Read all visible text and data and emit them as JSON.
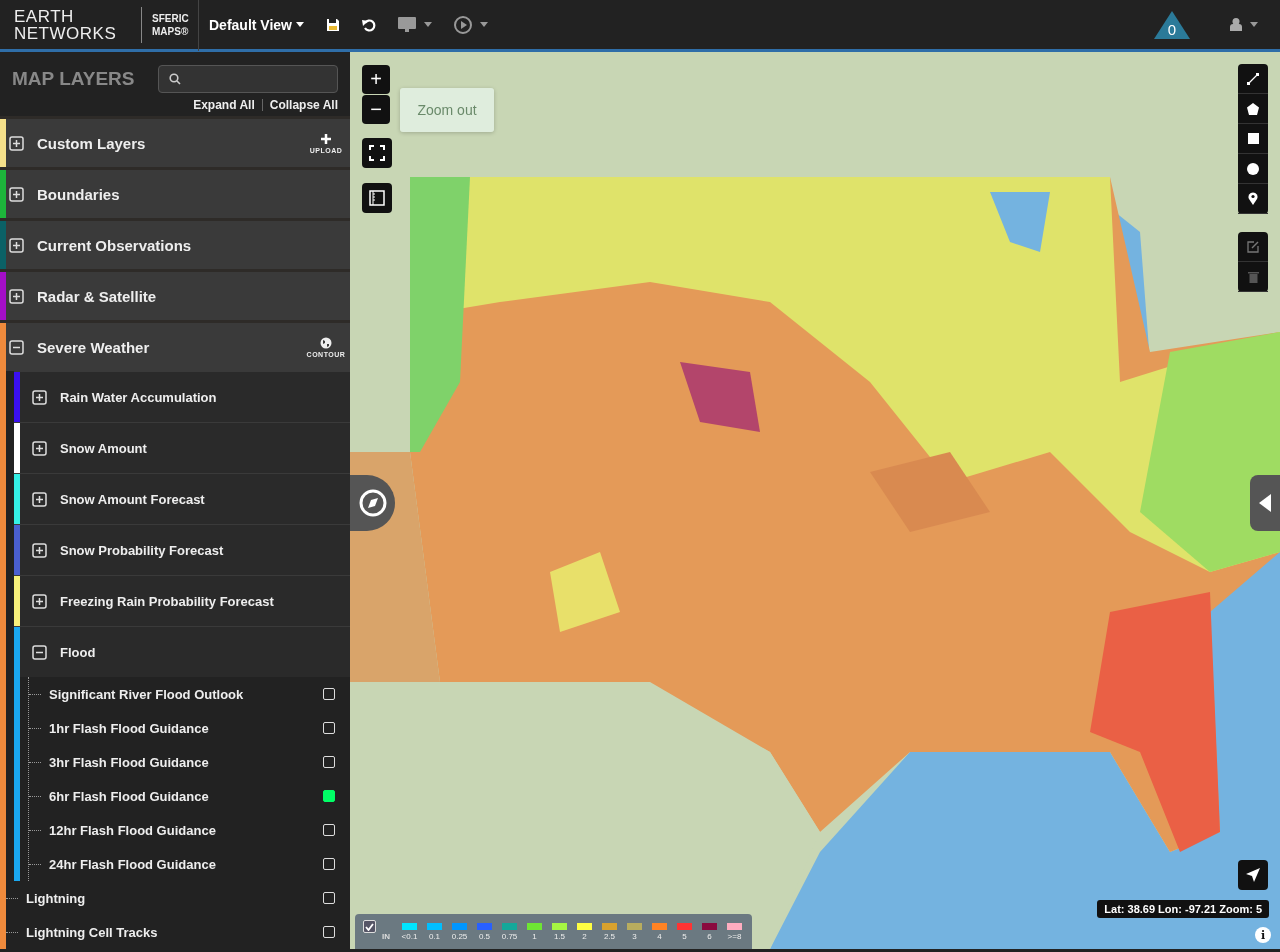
{
  "header": {
    "logo": {
      "line1": "EARTH",
      "line2": "NETWORKS"
    },
    "product": {
      "line1": "SFERIC",
      "line2": "MAPS®"
    },
    "view_menu": "Default View",
    "alert_count": "0"
  },
  "sidebar": {
    "title": "MAP LAYERS",
    "links": [
      "Expand All",
      "Collapse All"
    ],
    "groups": [
      {
        "label": "Custom Layers",
        "color": "#f5e08a",
        "expanded": false,
        "action": {
          "kind": "upload",
          "label": "UPLOAD"
        }
      },
      {
        "label": "Boundaries",
        "color": "#1db53b",
        "expanded": false
      },
      {
        "label": "Current Observations",
        "color": "#0b6166",
        "expanded": false
      },
      {
        "label": "Radar & Satellite",
        "color": "#a40ec7",
        "expanded": false
      },
      {
        "label": "Severe Weather",
        "color": "#ef8a3c",
        "expanded": true,
        "action": {
          "kind": "contour",
          "label": "CONTOUR"
        },
        "children": [
          {
            "kind": "group",
            "label": "Rain Water Accumulation",
            "color": "#3a10f0",
            "expanded": false
          },
          {
            "kind": "group",
            "label": "Snow Amount",
            "color": "#ffffff",
            "expanded": false
          },
          {
            "kind": "group",
            "label": "Snow Amount Forecast",
            "color": "#35f0e6",
            "expanded": false
          },
          {
            "kind": "group",
            "label": "Snow Probability Forecast",
            "color": "#4a5fd0",
            "expanded": false
          },
          {
            "kind": "group",
            "label": "Freezing Rain Probability Forecast",
            "color": "#f7f07a",
            "expanded": false
          },
          {
            "kind": "group",
            "label": "Flood",
            "color": "#1aa8f0",
            "expanded": true,
            "children": [
              {
                "kind": "layer",
                "label": "Significant River Flood Outlook",
                "checked": false
              },
              {
                "kind": "layer",
                "label": "1hr Flash Flood Guidance",
                "checked": false
              },
              {
                "kind": "layer",
                "label": "3hr Flash Flood Guidance",
                "checked": false
              },
              {
                "kind": "layer",
                "label": "6hr Flash Flood Guidance",
                "checked": true
              },
              {
                "kind": "layer",
                "label": "12hr Flash Flood Guidance",
                "checked": false
              },
              {
                "kind": "layer",
                "label": "24hr Flash Flood Guidance",
                "checked": false
              }
            ]
          },
          {
            "kind": "layer",
            "label": "Lightning",
            "checked": false
          },
          {
            "kind": "layer",
            "label": "Lightning Cell Tracks",
            "checked": false
          }
        ]
      }
    ]
  },
  "map": {
    "zoom_in": "+",
    "zoom_out": "−",
    "tooltip": "Zoom out",
    "coordinates": "Lat: 38.69 Lon: -97.21 Zoom: 5",
    "info": "i",
    "legend": {
      "checked": true,
      "unit": "IN",
      "items": [
        {
          "label": "<0.1",
          "color": "#00e5ff"
        },
        {
          "label": "0.1",
          "color": "#00bfff"
        },
        {
          "label": "0.25",
          "color": "#0096ff"
        },
        {
          "label": "0.5",
          "color": "#2860ff"
        },
        {
          "label": "0.75",
          "color": "#14a89a"
        },
        {
          "label": "1",
          "color": "#6ee633"
        },
        {
          "label": "1.5",
          "color": "#a6f542"
        },
        {
          "label": "2",
          "color": "#ffff42"
        },
        {
          "label": "2.5",
          "color": "#d9a22e"
        },
        {
          "label": "3",
          "color": "#b8ad5e"
        },
        {
          "label": "4",
          "color": "#ff8324"
        },
        {
          "label": "5",
          "color": "#ff3333"
        },
        {
          "label": "6",
          "color": "#8a0a3f"
        },
        {
          "label": ">=8",
          "color": "#ffadc0"
        }
      ]
    }
  }
}
